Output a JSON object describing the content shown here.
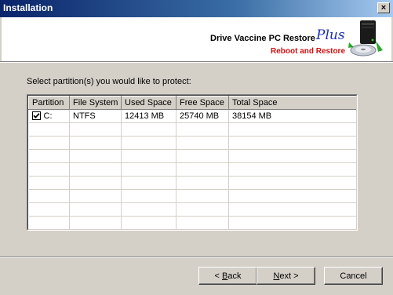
{
  "window": {
    "title": "Installation",
    "close_glyph": "×"
  },
  "header": {
    "product_name": "Drive Vaccine PC Restore",
    "product_plus": "Plus",
    "subtitle": "Reboot and Restore",
    "logo_icon": "computer-disk-icon"
  },
  "instruction": "Select partition(s) you would like to protect:",
  "table": {
    "columns": [
      "Partition",
      "File System",
      "Used Space",
      "Free Space",
      "Total Space"
    ],
    "rows": [
      {
        "checked": true,
        "partition": "C:",
        "file_system": "NTFS",
        "used": "12413 MB",
        "free": "25740 MB",
        "total": "38154 MB"
      }
    ]
  },
  "buttons": {
    "back": {
      "prefix": "< ",
      "mnemonic": "B",
      "rest": "ack"
    },
    "next": {
      "mnemonic": "N",
      "rest": "ext >"
    },
    "cancel": "Cancel"
  },
  "colors": {
    "titlebar": "#0a246a",
    "plus": "#1a2fb0",
    "subtitle": "#d01010",
    "face": "#d4d0c8"
  }
}
